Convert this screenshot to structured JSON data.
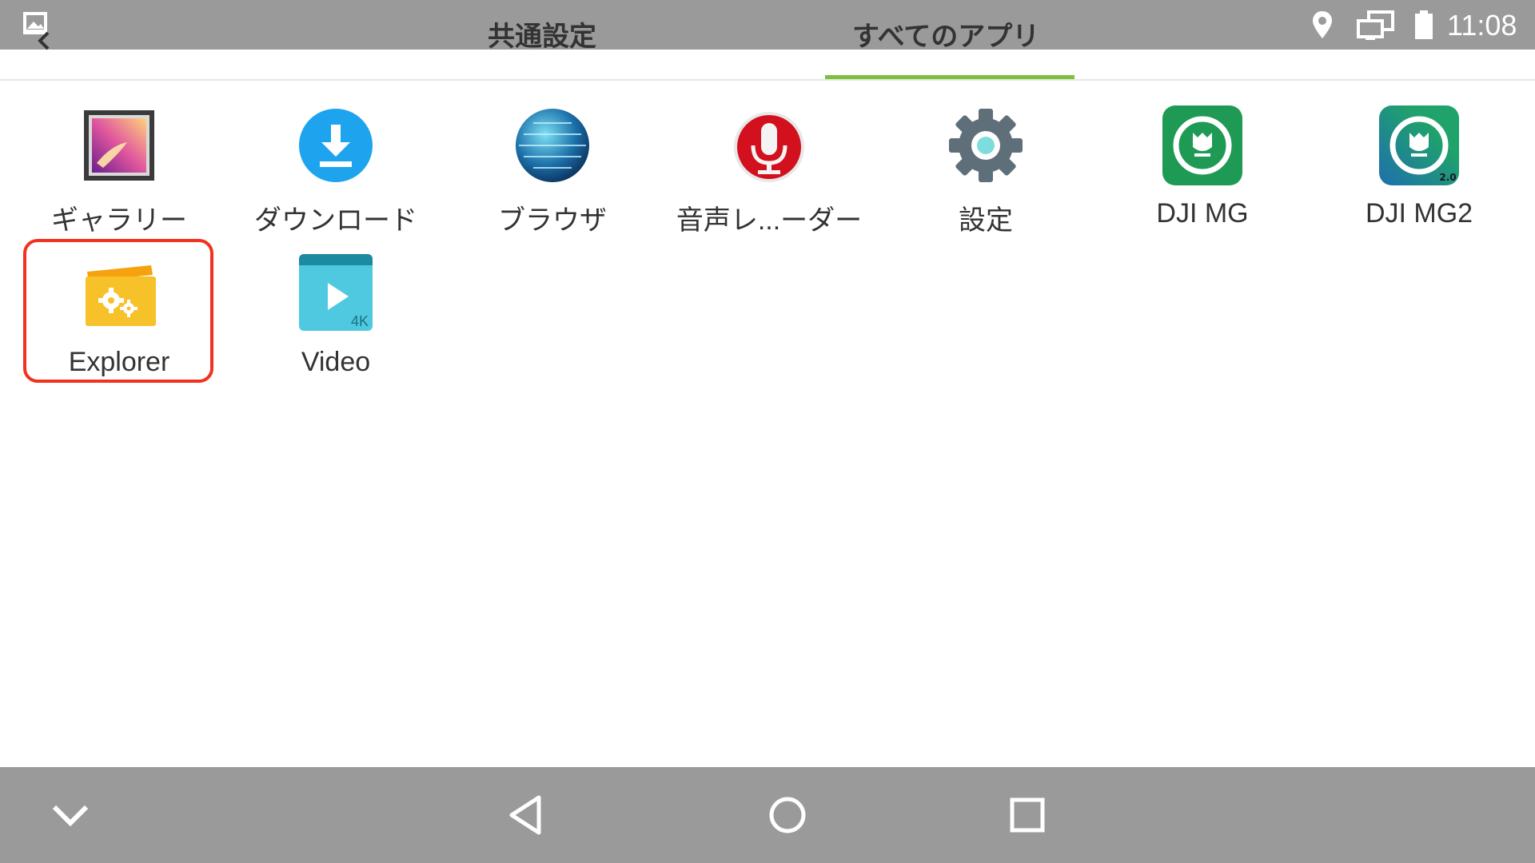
{
  "status_bar": {
    "time": "11:08",
    "icons": [
      "image-thumbnail-icon",
      "location-icon",
      "screens-icon",
      "battery-icon"
    ]
  },
  "tabs": [
    {
      "label": "共通設定",
      "active": false
    },
    {
      "label": "すべてのアプリ",
      "active": true
    }
  ],
  "apps": [
    {
      "label": "ギャラリー",
      "icon": "gallery-icon"
    },
    {
      "label": "ダウンロード",
      "icon": "download-icon"
    },
    {
      "label": "ブラウザ",
      "icon": "browser-globe-icon"
    },
    {
      "label": "音声レ...ーダー",
      "icon": "microphone-icon"
    },
    {
      "label": "設定",
      "icon": "gear-icon"
    },
    {
      "label": "DJI MG",
      "icon": "dji-mg-icon"
    },
    {
      "label": "DJI MG2",
      "icon": "dji-mg2-icon",
      "badge": "2.0"
    },
    {
      "label": "Explorer",
      "icon": "folder-settings-icon",
      "highlighted": true
    },
    {
      "label": "Video",
      "icon": "video-play-icon",
      "badge": "4K"
    }
  ],
  "nav_bar": {
    "icons": [
      "collapse-chevron-icon",
      "back-triangle-icon",
      "home-circle-icon",
      "recents-square-icon"
    ]
  },
  "colors": {
    "bar_gray": "#9a9a9a",
    "tab_indicator": "#7cc23f",
    "highlight_red": "#f0321e"
  }
}
